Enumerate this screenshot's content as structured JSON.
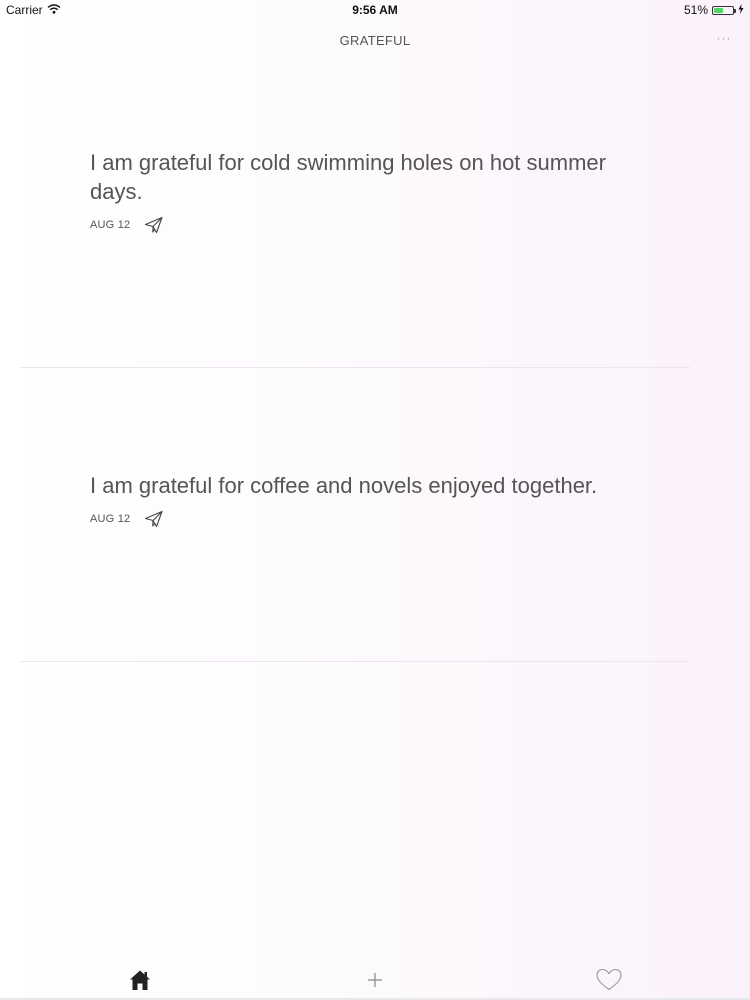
{
  "status_bar": {
    "carrier": "Carrier",
    "time": "9:56 AM",
    "battery": "51%",
    "battery_level": 0.51
  },
  "header": {
    "title": "GRATEFUL",
    "more_label": "···"
  },
  "entries": [
    {
      "text": "I am grateful for cold swimming holes on hot summer days.",
      "date": "AUG 12"
    },
    {
      "text": "I am grateful for coffee and novels enjoyed together.",
      "date": "AUG 12"
    }
  ],
  "tabs": [
    {
      "name": "home",
      "icon": "home-icon",
      "active": true
    },
    {
      "name": "add",
      "icon": "plus-icon",
      "active": false
    },
    {
      "name": "favorites",
      "icon": "heart-icon",
      "active": false
    }
  ]
}
